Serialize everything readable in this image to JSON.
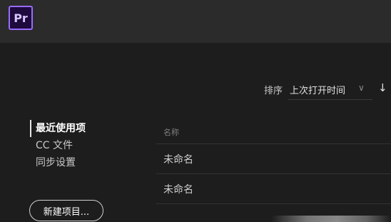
{
  "app": {
    "logo_text": "Pr"
  },
  "sort": {
    "label": "排序",
    "value": "上次打开时间",
    "chevron_icon": "chevron-down-icon",
    "direction_icon": "arrow-down-icon"
  },
  "nav": {
    "items": [
      {
        "label": "最近使用项",
        "active": true
      },
      {
        "label": "CC 文件",
        "active": false
      },
      {
        "label": "同步设置",
        "active": false
      }
    ],
    "new_project_label": "新建项目..."
  },
  "list": {
    "header": "名称",
    "rows": [
      {
        "name": "未命名"
      },
      {
        "name": "未命名"
      }
    ]
  },
  "colors": {
    "accent": "#9a6bff",
    "topbar": "#2b2b2b",
    "background": "#1d1d1d"
  }
}
